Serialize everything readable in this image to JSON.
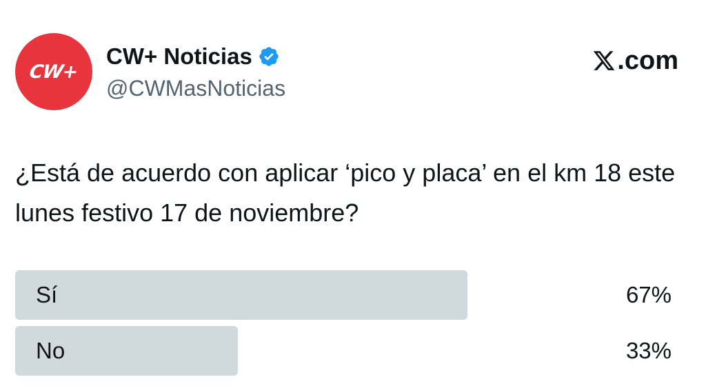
{
  "account": {
    "avatar_text": "CW+",
    "display_name": "CW+ Noticias",
    "handle": "@CWMasNoticias",
    "verified": true,
    "avatar_color": "#e8343c",
    "verified_color": "#1d9bf0"
  },
  "site": {
    "label": ".com",
    "icon": "x-logo-icon"
  },
  "post": {
    "question": "¿Está de acuerdo con aplicar ‘pico y placa’ en el km 18 este lunes festivo 17 de noviembre?"
  },
  "poll": {
    "options": [
      {
        "label": "Sí",
        "percent_text": "67%",
        "percent": 67
      },
      {
        "label": "No",
        "percent_text": "33%",
        "percent": 33
      }
    ],
    "bar_color": "#cfd9de"
  }
}
